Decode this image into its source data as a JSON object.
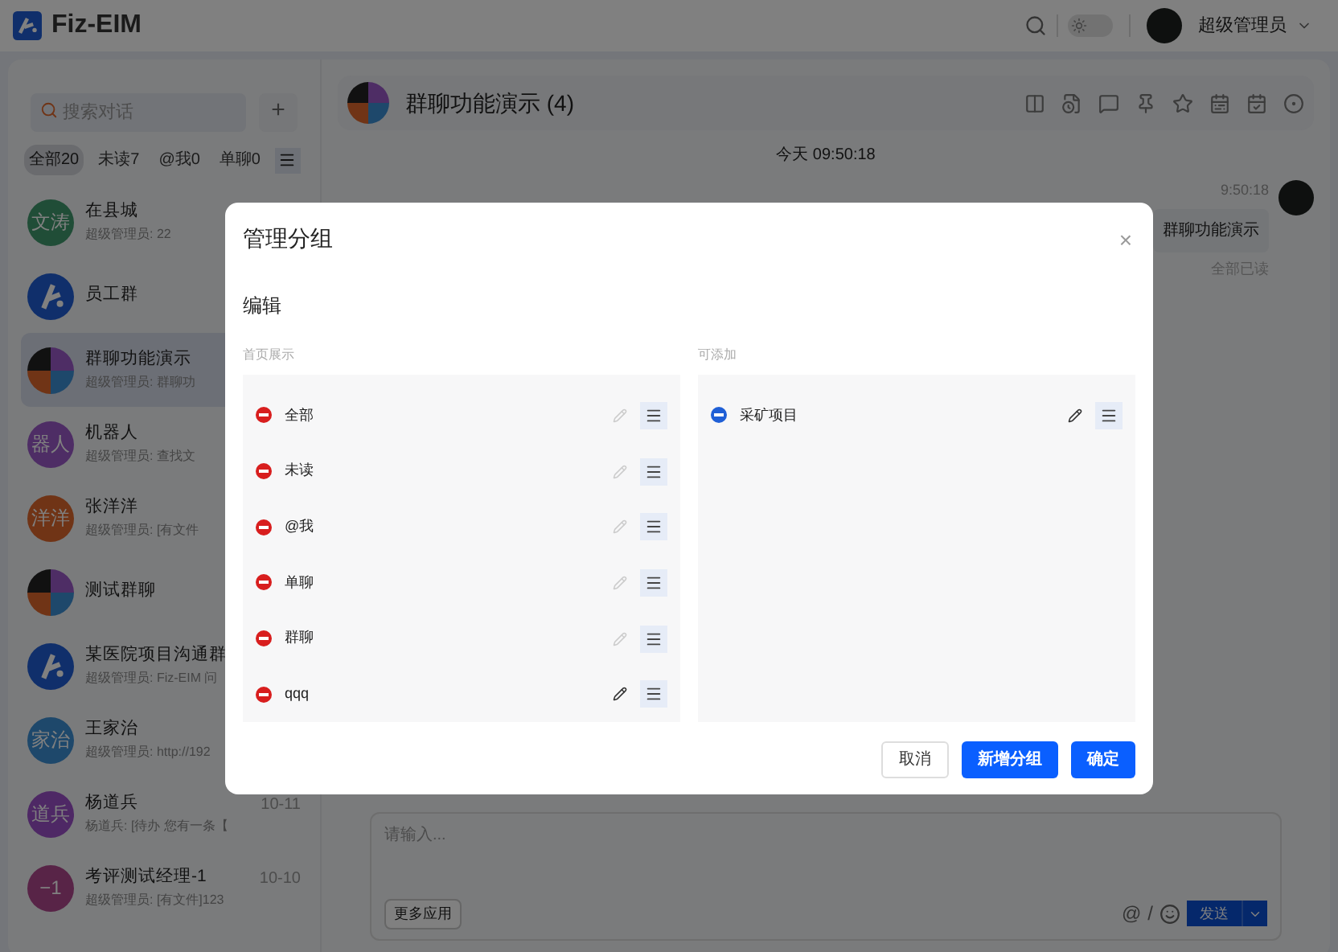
{
  "app": {
    "name": "Fiz-EIM",
    "dark_mode": false,
    "user": "超级管理员"
  },
  "sidebar": {
    "search": {
      "placeholder": "搜索对话"
    },
    "add_button": "+",
    "filters": [
      {
        "label": "全部20",
        "selected": true
      },
      {
        "label": "未读7",
        "selected": false
      },
      {
        "label": "@我0",
        "selected": false
      },
      {
        "label": "单聊0",
        "selected": false
      }
    ],
    "chats": [
      {
        "name": "在县城",
        "preview": "超级管理员: 22",
        "avatar": {
          "kind": "text",
          "text": "文涛",
          "color": "#204d37"
        },
        "selected": false
      },
      {
        "name": "员工群",
        "avatar": {
          "kind": "logo"
        },
        "selected": false
      },
      {
        "name": "群聊功能演示",
        "preview": "超级管理员: 群聊功",
        "avatar": {
          "kind": "grid"
        },
        "selected": true
      },
      {
        "name": "机器人",
        "preview": "超级管理员: 查找文",
        "avatar": {
          "kind": "text",
          "text": "器人",
          "color": "#4e2d65"
        },
        "selected": false
      },
      {
        "name": "张洋洋",
        "preview": "超级管理员: [有文件",
        "avatar": {
          "kind": "text",
          "text": "洋洋",
          "color": "#703416"
        },
        "selected": false
      },
      {
        "name": "测试群聊",
        "avatar": {
          "kind": "grid"
        },
        "selected": false
      },
      {
        "name": "某医院项目沟通群",
        "preview": "超级管理员: Fiz-EIM 问",
        "avatar": {
          "kind": "logo"
        },
        "selected": false
      },
      {
        "name": "王家治",
        "preview": "超级管理员: http://192",
        "avatar": {
          "kind": "text",
          "text": "家治",
          "color": "#1e486b"
        },
        "selected": false
      },
      {
        "name": "杨道兵",
        "preview": "杨道兵: [待办 您有一条【",
        "time": "10-11",
        "avatar": {
          "kind": "text",
          "text": "道兵",
          "color": "#4e2865"
        },
        "selected": false
      },
      {
        "name": "考评测试经理-1",
        "preview": "超级管理员: [有文件]123",
        "time": "10-10",
        "avatar": {
          "kind": "text",
          "text": "−1",
          "color": "#582447"
        },
        "selected": false
      }
    ]
  },
  "chat": {
    "title": "群聊功能演示 (4)",
    "date": "今天 09:50:18",
    "message": {
      "time": "9:50:18",
      "text": "群聊功能演示",
      "status": "全部已读"
    },
    "input": {
      "placeholder": "请输入...",
      "more_button": "更多应用",
      "at": "@",
      "slash": "/",
      "send_button": "发送"
    }
  },
  "dialog": {
    "title": "管理分组",
    "close": "×",
    "section": "编辑",
    "columns": [
      {
        "title": "首页展示",
        "items": [
          {
            "label": "全部",
            "kind": "remove",
            "editable": false
          },
          {
            "label": "未读",
            "kind": "remove",
            "editable": false
          },
          {
            "label": "@我",
            "kind": "remove",
            "editable": false
          },
          {
            "label": "单聊",
            "kind": "remove",
            "editable": false
          },
          {
            "label": "群聊",
            "kind": "remove",
            "editable": false
          },
          {
            "label": "qqq",
            "kind": "remove",
            "editable": true
          }
        ]
      },
      {
        "title": "可添加",
        "items": [
          {
            "label": "采矿项目",
            "kind": "add",
            "editable": true
          }
        ]
      }
    ],
    "buttons": [
      {
        "label": "取消",
        "kind": "secondary"
      },
      {
        "label": "新增分组",
        "kind": "primary"
      },
      {
        "label": "确定",
        "kind": "primary"
      }
    ]
  }
}
